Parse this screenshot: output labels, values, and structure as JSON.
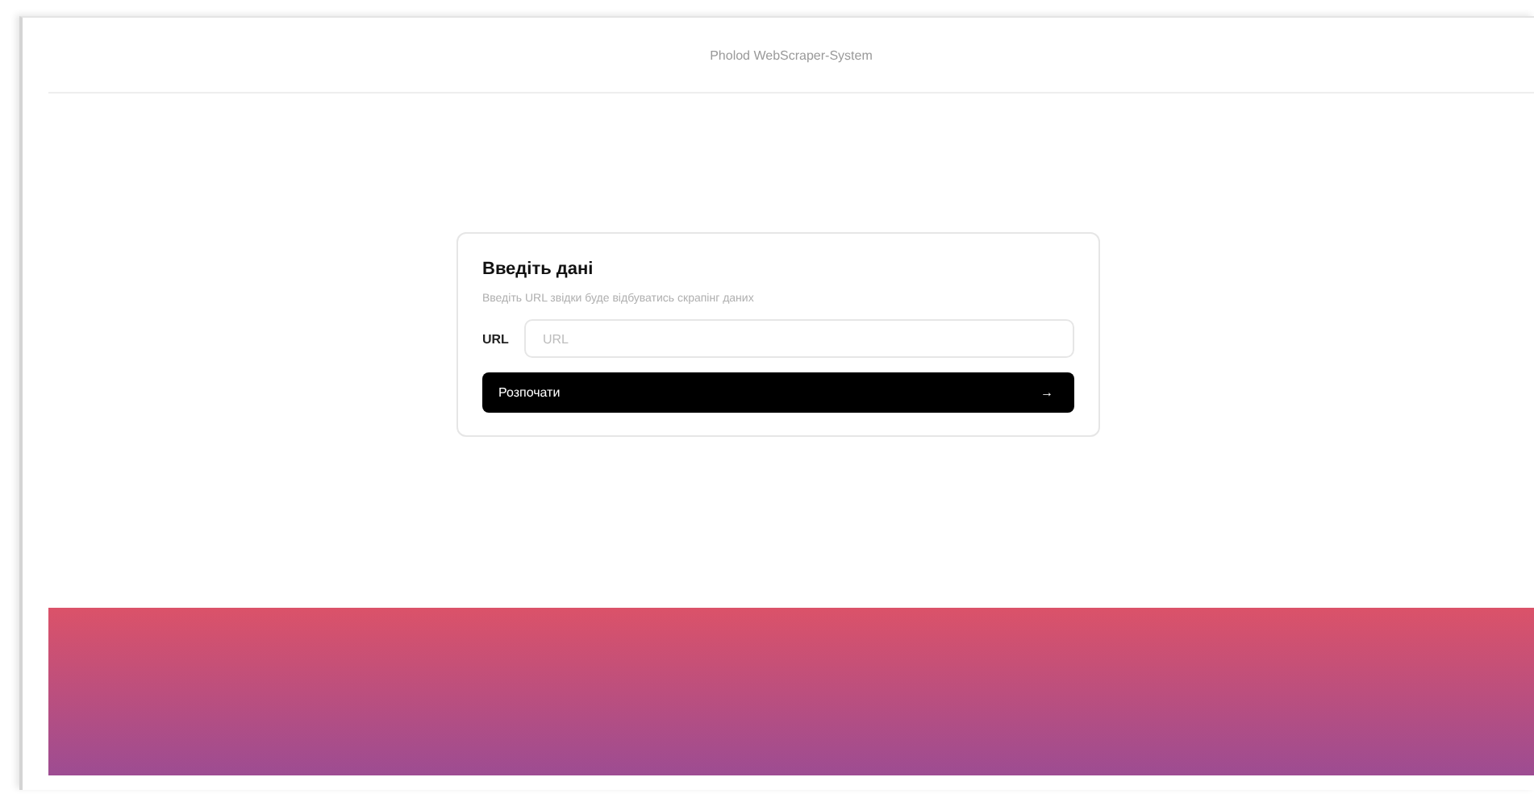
{
  "header": {
    "title": "Pholod WebScraper-System"
  },
  "form": {
    "title": "Введіть дані",
    "description": "Введіть URL звідки буде відбуватись скрапінг даних",
    "field_label": "URL",
    "field": {
      "placeholder": "URL"
    },
    "submit": {
      "label": "Розпочати",
      "icon": "→"
    }
  },
  "banner": {
    "kind": "gradient"
  }
}
